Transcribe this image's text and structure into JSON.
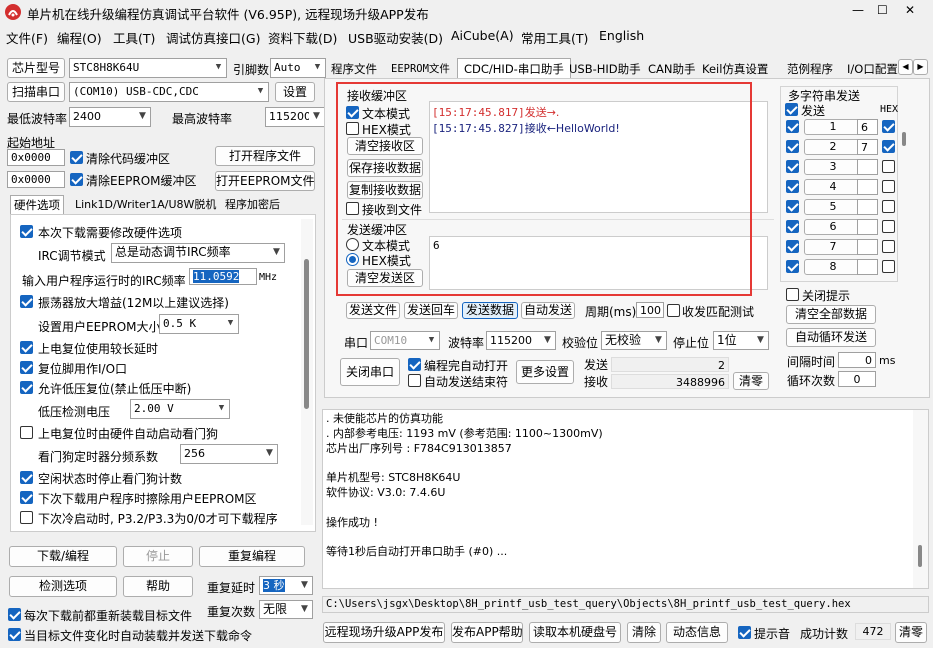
{
  "window": {
    "title": "单片机在线升级编程仿真调试平台软件 (V6.95P), 远程现场升级APP发布",
    "min": "—",
    "max": "☐",
    "close": "✕"
  },
  "menu": [
    "文件(F)",
    "编程(O)",
    "工具(T)",
    "调试仿真接口(G)",
    "资料下载(D)",
    "USB驱动安装(D)",
    "AiCube(A)",
    "常用工具(T)",
    "English"
  ],
  "left": {
    "chip_label": "芯片型号",
    "chip_value": "STC8H8K64U",
    "pin_label": "引脚数",
    "pin_value": "Auto",
    "scan_label": "扫描串口",
    "port_value": "(COM10) USB-CDC,CDC",
    "settings_btn": "设置",
    "min_baud_label": "最低波特率",
    "min_baud": "2400",
    "max_baud_label": "最高波特率",
    "max_baud": "115200",
    "start_addr_label": "起始地址",
    "addr1": "0x0000",
    "clear_code": "清除代码缓冲区",
    "open_prog": "打开程序文件",
    "addr2": "0x0000",
    "clear_eeprom": "清除EEPROM缓冲区",
    "open_eeprom": "打开EEPROM文件",
    "tabs": [
      "硬件选项",
      "Link1D/Writer1A/U8W脱机",
      "程序加密后"
    ],
    "hw": {
      "opt1": "本次下载需要修改硬件选项",
      "irc_mode_label": "IRC调节模式",
      "irc_mode_value": "总是动态调节IRC频率",
      "irc_freq_label": "输入用户程序运行时的IRC频率",
      "irc_freq_value": "11.0592",
      "mhz": "MHz",
      "opt2": "振荡器放大增益(12M以上建议选择)",
      "eeprom_size_label": "设置用户EEPROM大小",
      "eeprom_size_value": "0.5 K",
      "opt3": "上电复位使用较长延时",
      "opt4": "复位脚用作I/O口",
      "opt5": "允许低压复位(禁止低压中断)",
      "lv_label": "低压检测电压",
      "lv_value": "2.00 V",
      "opt6": "上电复位时由硬件自动启动看门狗",
      "wdt_label": "看门狗定时器分频系数",
      "wdt_value": "256",
      "opt7": "空闲状态时停止看门狗计数",
      "opt8": "下次下载用户程序时擦除用户EEPROM区",
      "opt9": "下次冷启动时, P3.2/P3.3为0/0才可下载程序"
    },
    "download_btn": "下载/编程",
    "stop_btn": "停止",
    "reprogram_btn": "重复编程",
    "detect_btn": "检测选项",
    "help_btn": "帮助",
    "repeat_delay_label": "重复延时",
    "repeat_delay_value": "3 秒",
    "reload_cb": "每次下载前都重新装载目标文件",
    "repeat_count_label": "重复次数",
    "repeat_count_value": "无限",
    "autoload_cb": "当目标文件变化时自动装载并发送下载命令"
  },
  "right": {
    "tabs": [
      "程序文件",
      "EEPROM文件",
      "CDC/HID-串口助手",
      "USB-HID助手",
      "CAN助手",
      "Keil仿真设置",
      "范例程序",
      "I/O口配置"
    ],
    "recv": {
      "title": "接收缓冲区",
      "text_mode": "文本模式",
      "hex_mode": "HEX模式",
      "clear_btn": "清空接收区",
      "save_btn": "保存接收数据",
      "copy_btn": "复制接收数据",
      "to_file": "接收到文件",
      "line1_time": "[15:17:45.817]",
      "line1_text": "发送→.",
      "line2_time": "[15:17:45.827]",
      "line2_text": "接收←HelloWorld!"
    },
    "send": {
      "title": "发送缓冲区",
      "text_mode": "文本模式",
      "hex_mode": "HEX模式",
      "clear_btn": "清空发送区",
      "content": "6"
    },
    "multi": {
      "title": "多字符串发送",
      "send_hdr": "发送",
      "hex_hdr": "HEX",
      "rows": [
        {
          "n": "1",
          "v": "6"
        },
        {
          "n": "2",
          "v": "7"
        },
        {
          "n": "3",
          "v": ""
        },
        {
          "n": "4",
          "v": ""
        },
        {
          "n": "5",
          "v": ""
        },
        {
          "n": "6",
          "v": ""
        },
        {
          "n": "7",
          "v": ""
        },
        {
          "n": "8",
          "v": ""
        }
      ],
      "close_tip": "关闭提示",
      "clear_all": "清空全部数据",
      "auto_loop": "自动循环发送",
      "interval_label": "间隔时间",
      "interval_value": "0",
      "ms": "ms",
      "loop_label": "循环次数",
      "loop_value": "0"
    },
    "send_file": "发送文件",
    "send_back": "发送回车",
    "send_data": "发送数据",
    "auto_send": "自动发送",
    "period_label": "周期(ms)",
    "period_value": "100",
    "match_test": "收发匹配测试",
    "port_label": "串口",
    "port_value": "COM10",
    "baud_label": "波特率",
    "baud_value": "115200",
    "parity_label": "校验位",
    "parity_value": "无校验",
    "stop_label": "停止位",
    "stop_value": "1位",
    "close_port": "关闭串口",
    "auto_open": "编程完自动打开",
    "auto_send_end": "自动发送结束符",
    "more_settings": "更多设置",
    "tx_label": "发送",
    "tx_value": "2",
    "rx_label": "接收",
    "rx_value": "3488996",
    "clear_count": "清零",
    "log": [
      ". 未使能芯片的仿真功能",
      ". 内部参考电压: 1193 mV (参考范围: 1100~1300mV)",
      "芯片出厂序列号 : F784C913013857",
      "",
      "单片机型号: STC8H8K64U",
      "软件协议: V3.0: 7.4.6U",
      "",
      "操作成功 !",
      "",
      "等待1秒后自动打开串口助手 (#0) ..."
    ],
    "path": "C:\\Users\\jsgx\\Desktop\\8H_printf_usb_test_query\\Objects\\8H_printf_usb_test_query.hex",
    "bottom": {
      "remote": "远程现场升级APP发布",
      "help": "发布APP帮助",
      "read_disk": "读取本机硬盘号",
      "clear": "清除",
      "dyn_info": "动态信息",
      "beep": "提示音",
      "success_label": "成功计数",
      "success_value": "472",
      "clear2": "清零"
    }
  },
  "colors": {
    "accent": "#1565c0",
    "highlight": "#e53935",
    "recv_send": "#d32f2f",
    "recv_text": "#1a237e"
  }
}
